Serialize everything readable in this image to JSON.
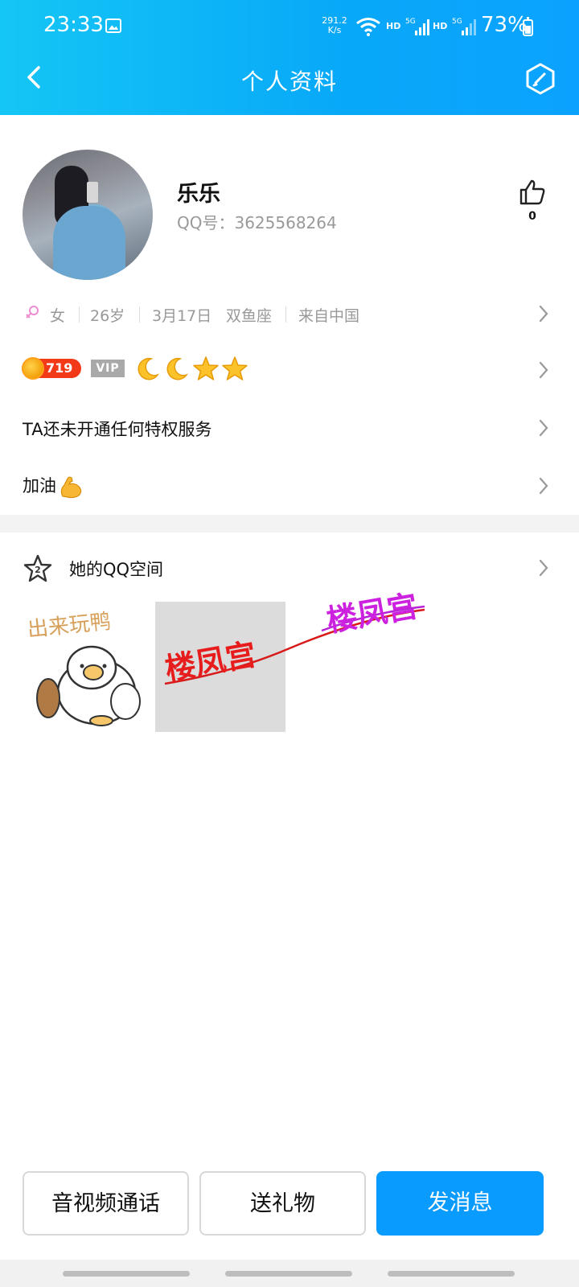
{
  "status_bar": {
    "time": "23:33",
    "net_speed_value": "291.2",
    "net_speed_unit": "K/s",
    "hd_1": "HD",
    "hd_2": "HD",
    "battery": "73%"
  },
  "header": {
    "title": "个人资料"
  },
  "profile": {
    "name": "乐乐",
    "qq_number": "QQ号：3625568264",
    "like_count": "0"
  },
  "info": {
    "gender": "女",
    "age": "26岁",
    "birthday": "3月17日",
    "zodiac": "双鱼座",
    "location": "来自中国"
  },
  "badges": {
    "level": "719",
    "vip": "VIP"
  },
  "privilege": {
    "text": "TA还未开通任何特权服务"
  },
  "signature": {
    "text": "加油"
  },
  "qzone": {
    "label": "她的QQ空间",
    "thumb1_text": "出来玩鸭",
    "watermark_1": "楼凤宫",
    "watermark_2": "楼凤宫"
  },
  "actions": {
    "call": "音视频通话",
    "gift": "送礼物",
    "message": "发消息"
  },
  "colors": {
    "header_accent": "#0ba2ff",
    "primary_button": "#0a9bff",
    "level_badge": "#f23a18"
  }
}
